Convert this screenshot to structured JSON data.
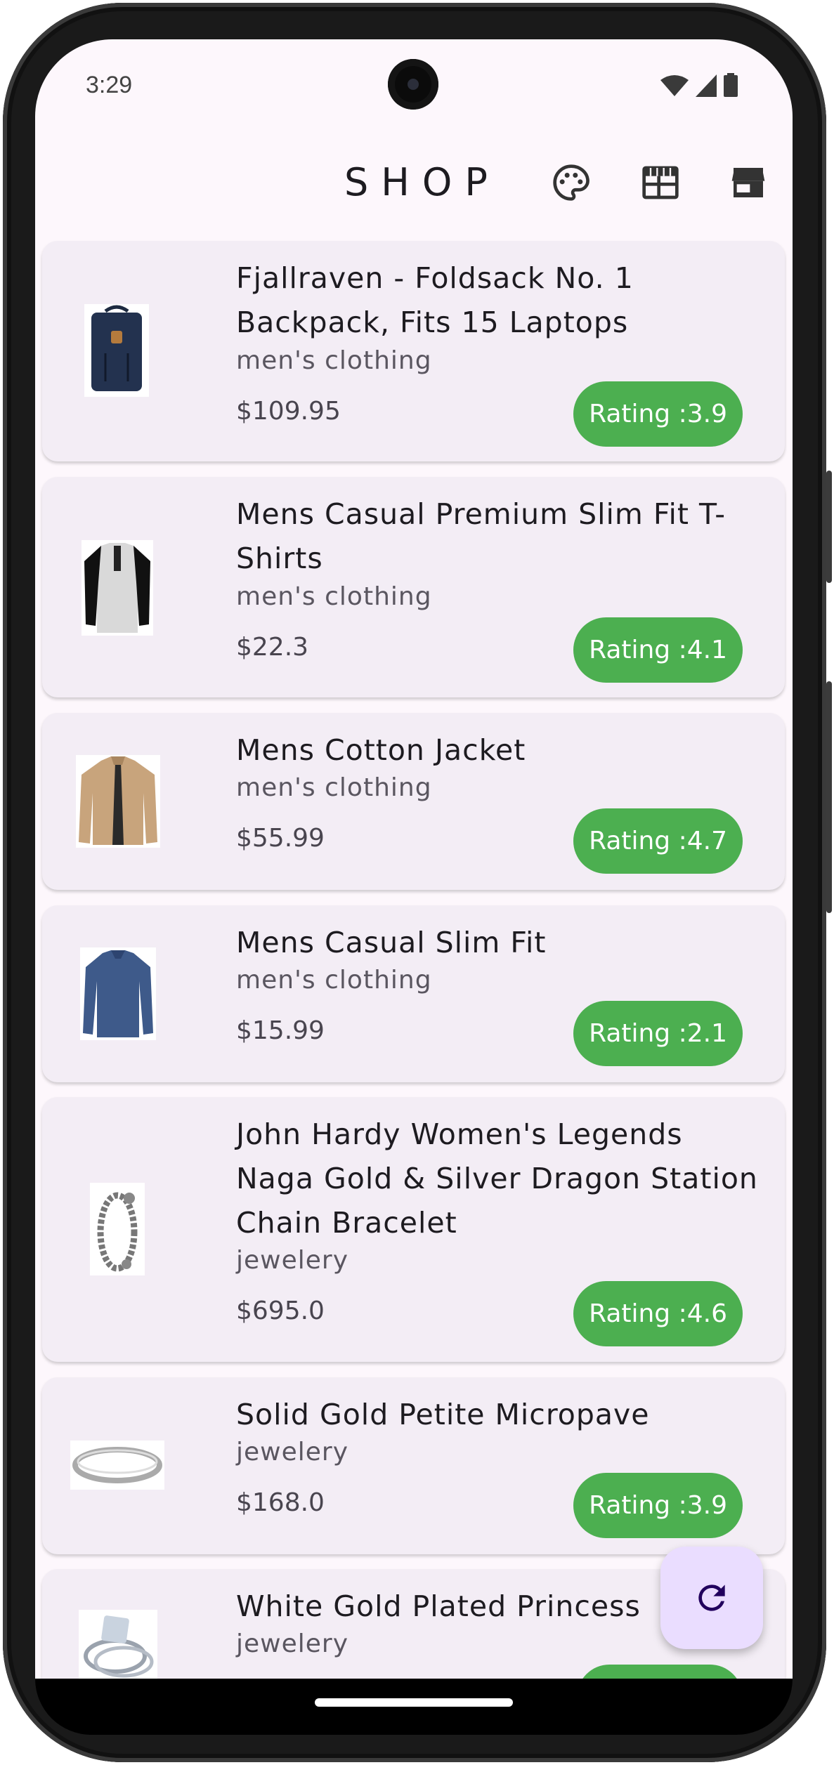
{
  "status_bar": {
    "time": "3:29"
  },
  "app_bar": {
    "title": "SHOP",
    "icons": [
      "palette-icon",
      "table-icon",
      "store-icon"
    ]
  },
  "products": [
    {
      "title": "Fjallraven - Foldsack No. 1 Backpack, Fits 15 Laptops",
      "category": "men's clothing",
      "price": "$109.95",
      "rating": "Rating :3.9",
      "thumb": "backpack"
    },
    {
      "title": "Mens Casual Premium Slim Fit T-Shirts",
      "category": "men's clothing",
      "price": "$22.3",
      "rating": "Rating :4.1",
      "thumb": "tshirt"
    },
    {
      "title": "Mens Cotton Jacket",
      "category": "men's clothing",
      "price": "$55.99",
      "rating": "Rating :4.7",
      "thumb": "jacket"
    },
    {
      "title": "Mens Casual Slim Fit",
      "category": "men's clothing",
      "price": "$15.99",
      "rating": "Rating :2.1",
      "thumb": "longsleeve"
    },
    {
      "title": "John Hardy Women's Legends Naga Gold & Silver Dragon Station Chain Bracelet",
      "category": "jewelery",
      "price": "$695.0",
      "rating": "Rating :4.6",
      "thumb": "bracelet"
    },
    {
      "title": "Solid Gold Petite Micropave",
      "category": "jewelery",
      "price": "$168.0",
      "rating": "Rating :3.9",
      "thumb": "ring"
    },
    {
      "title": "White Gold Plated Princess",
      "category": "jewelery",
      "price": "",
      "rating": "",
      "thumb": "ringset"
    }
  ],
  "fab": {
    "icon": "refresh-icon"
  },
  "colors": {
    "rating_bg": "#4caf50",
    "card_bg": "#f3edf5",
    "screen_bg": "#fdf7fc",
    "fab_bg": "#eaddff"
  }
}
